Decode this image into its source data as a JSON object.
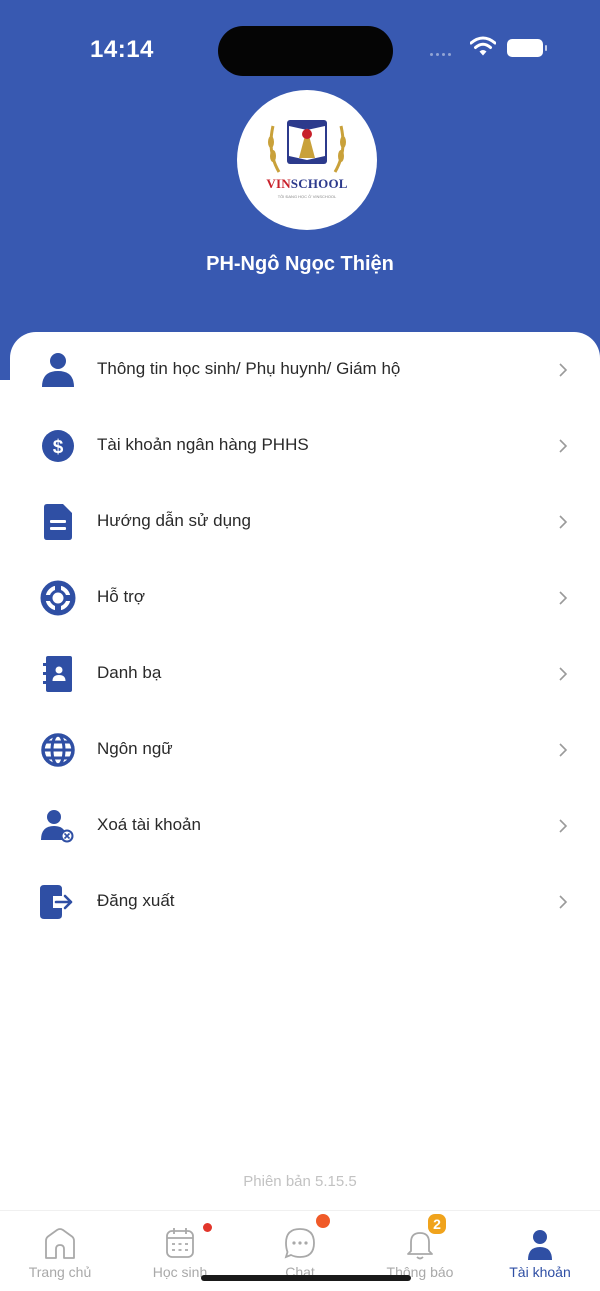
{
  "status_bar": {
    "time": "14:14"
  },
  "header": {
    "logo": {
      "text_red": "VIN",
      "text_blue": "SCHOOL",
      "tagline": "TÔI ĐANG HỌC Ở VINSCHOOL"
    },
    "user_name": "PH-Ngô Ngọc Thiện",
    "background_color": "#3859b1"
  },
  "menu": {
    "items": [
      {
        "label": "Thông tin học sinh/ Phụ huynh/ Giám hộ",
        "icon": "person-icon"
      },
      {
        "label": "Tài khoản ngân hàng PHHS",
        "icon": "dollar-circle-icon"
      },
      {
        "label": "Hướng dẫn sử dụng",
        "icon": "document-icon"
      },
      {
        "label": "Hỗ trợ",
        "icon": "lifebuoy-icon"
      },
      {
        "label": "Danh bạ",
        "icon": "contact-book-icon"
      },
      {
        "label": "Ngôn ngữ",
        "icon": "globe-icon"
      },
      {
        "label": "Xoá tài khoản",
        "icon": "person-remove-icon"
      },
      {
        "label": "Đăng xuất",
        "icon": "logout-icon"
      }
    ],
    "chevron": "›",
    "icon_color": "#2f4fa4"
  },
  "version": "Phiên bản 5.15.5",
  "tabbar": {
    "tabs": [
      {
        "label": "Trang chủ",
        "icon": "home-icon",
        "active": false
      },
      {
        "label": "Học sinh",
        "icon": "calendar-icon",
        "active": false,
        "dot": true
      },
      {
        "label": "Chat",
        "icon": "chat-icon",
        "active": false,
        "dot": true
      },
      {
        "label": "Thông báo",
        "icon": "bell-icon",
        "active": false,
        "badge": "2"
      },
      {
        "label": "Tài khoản",
        "icon": "account-icon",
        "active": true
      }
    ],
    "active_color": "#2f4fa4",
    "inactive_color": "#a9a9a9"
  }
}
